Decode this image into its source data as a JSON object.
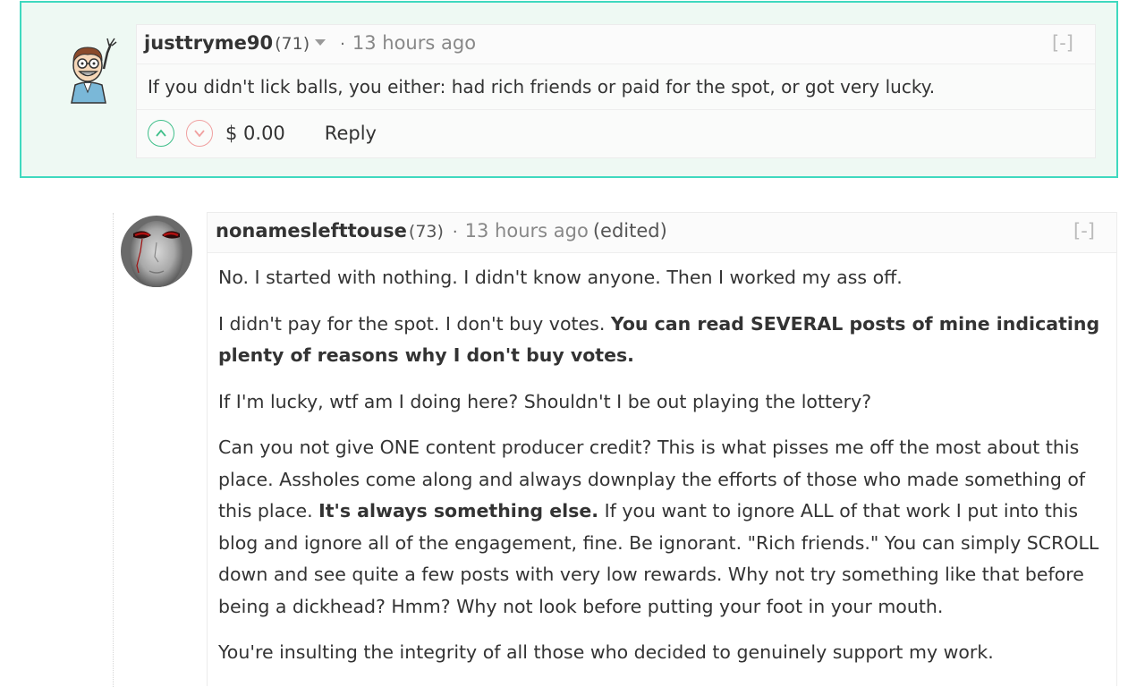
{
  "comments": [
    {
      "author": "justtryme90",
      "reputation": "(71)",
      "separator": "·",
      "time": "13 hours ago",
      "collapse_label": "[-]",
      "body": "If you didn't lick balls, you either: had rich friends or paid for the spot, or got very lucky.",
      "payout": "$ 0.00",
      "reply_label": "Reply"
    },
    {
      "author": "nonameslefttouse",
      "reputation": "(73)",
      "separator": "·",
      "time": "13 hours ago",
      "edited": "(edited)",
      "collapse_label": "[-]",
      "paragraphs": {
        "p1": "No. I started with nothing. I didn't know anyone. Then I worked my ass off.",
        "p2_plain": "I didn't pay for the spot. I don't buy votes. ",
        "p2_bold": "You can read SEVERAL posts of mine indicating plenty of reasons why I don't buy votes.",
        "p3": "If I'm lucky, wtf am I doing here? Shouldn't I be out playing the lottery?",
        "p4_part1": "Can you not give ONE content producer credit? This is what pisses me off the most about this place. Assholes come along and always downplay the efforts of those who made something of this place. ",
        "p4_bold": "It's always something else.",
        "p4_part2": " If you want to ignore ALL of that work I put into this blog and ignore all of the engagement, fine. Be ignorant. \"Rich friends.\" You can simply SCROLL down and see quite a few posts with very low rewards. Why not try something like that before being a dickhead? Hmm? Why not look before putting your foot in your mouth.",
        "p5": "You're insulting the integrity of all those who decided to genuinely support my work."
      }
    }
  ],
  "colors": {
    "highlight_border": "#3fd9bf",
    "highlight_bg": "#eef9f3",
    "upvote": "#3fbf8a",
    "downvote": "#f0a0a0"
  },
  "icons": [
    "cartoon-avatar-icon",
    "mask-avatar-icon",
    "chevron-up-icon",
    "chevron-down-icon",
    "caret-down-icon"
  ]
}
